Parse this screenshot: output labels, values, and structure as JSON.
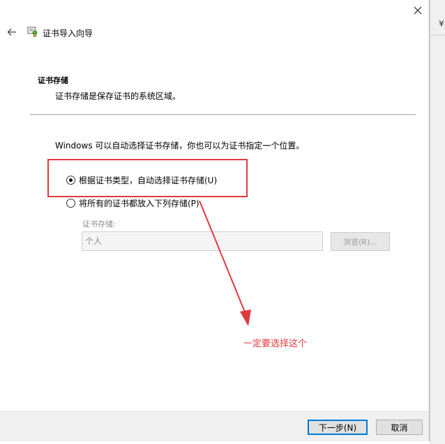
{
  "window": {
    "title": "证书导入向导"
  },
  "edge": {
    "char": "¥"
  },
  "header": {
    "section_title": "证书存储",
    "section_desc": "证书存储是保存证书的系统区域。"
  },
  "content": {
    "intro": "Windows 可以自动选择证书存储，你也可以为证书指定一个位置。",
    "options": [
      {
        "label": "根据证书类型，自动选择证书存储(U)",
        "checked": true
      },
      {
        "label": "将所有的证书都放入下列存储(P)",
        "checked": false
      }
    ],
    "store": {
      "label": "证书存储:",
      "value": "个人",
      "browse_label": "浏览(R)..."
    }
  },
  "annotation": {
    "text": "一定要选择这个",
    "color": "#e0393e"
  },
  "footer": {
    "next_label": "下一步(N)",
    "cancel_label": "取消"
  },
  "icons": {
    "close": "close-icon",
    "back": "back-arrow-icon",
    "wizard": "certificate-icon"
  },
  "colors": {
    "accent": "#0078d7",
    "annotation": "#e0393e",
    "footer_bg": "#f0f0f0"
  }
}
